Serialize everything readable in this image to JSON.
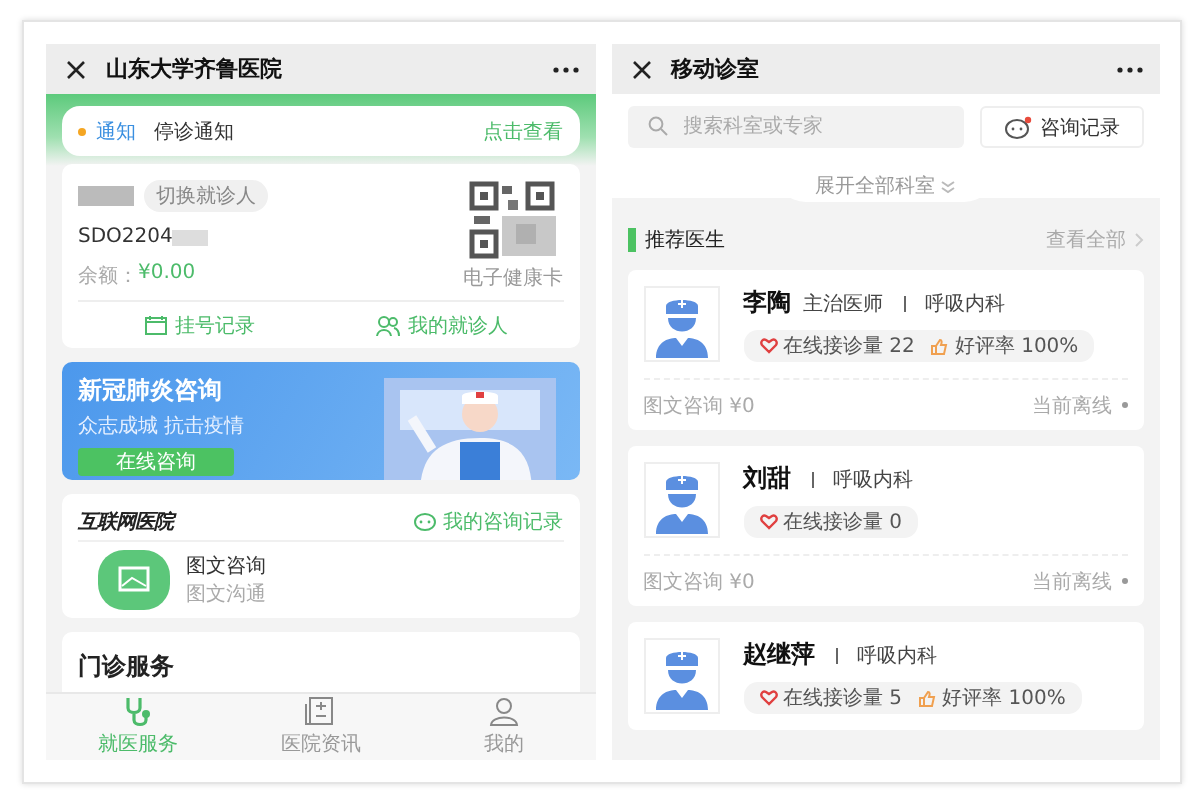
{
  "left": {
    "window": {
      "title": "山东大学齐鲁医院"
    },
    "notice": {
      "tag": "通知",
      "text": "停诊通知",
      "action": "点击查看"
    },
    "patient_card": {
      "switch_label": "切换就诊人",
      "id_text": "SDO2204",
      "balance_label": "余额：",
      "balance_value": "¥0.00",
      "qr_caption": "电子健康卡",
      "actions": [
        {
          "label": "挂号记录",
          "kind": "calendar"
        },
        {
          "label": "我的就诊人",
          "kind": "people"
        }
      ]
    },
    "banner": {
      "title": "新冠肺炎咨询",
      "subtitle": "众志成城 抗击疫情",
      "button": "在线咨询"
    },
    "internet_hospital": {
      "logo_text": "互联网医院",
      "record_link": "我的咨询记录",
      "services": [
        {
          "title": "图文咨询",
          "subtitle": "图文沟通"
        }
      ]
    },
    "outpatient": {
      "title": "门诊服务"
    },
    "tabbar": [
      {
        "label": "就医服务",
        "kind": "stethoscope",
        "selected": true
      },
      {
        "label": "医院资讯",
        "kind": "news",
        "selected": false
      },
      {
        "label": "我的",
        "kind": "person",
        "selected": false
      }
    ]
  },
  "right": {
    "window": {
      "title": "移动诊室"
    },
    "search": {
      "placeholder": "搜索科室或专家"
    },
    "record_button": "咨询记录",
    "expand_label": "展开全部科室",
    "section": {
      "title": "推荐医生",
      "more": "查看全部"
    },
    "doctors": [
      {
        "name": "李陶",
        "title": "主治医师",
        "department": "呼吸内科",
        "visits": "在线接诊量 22",
        "rating": "好评率 100%",
        "consult": "图文咨询 ¥0",
        "status": "当前离线"
      },
      {
        "name": "刘甜",
        "department": "呼吸内科",
        "visits": "在线接诊量 0",
        "consult": "图文咨询 ¥0",
        "status": "当前离线"
      },
      {
        "name": "赵继萍",
        "department": "呼吸内科",
        "visits": "在线接诊量 5",
        "rating": "好评率 100%"
      }
    ]
  }
}
